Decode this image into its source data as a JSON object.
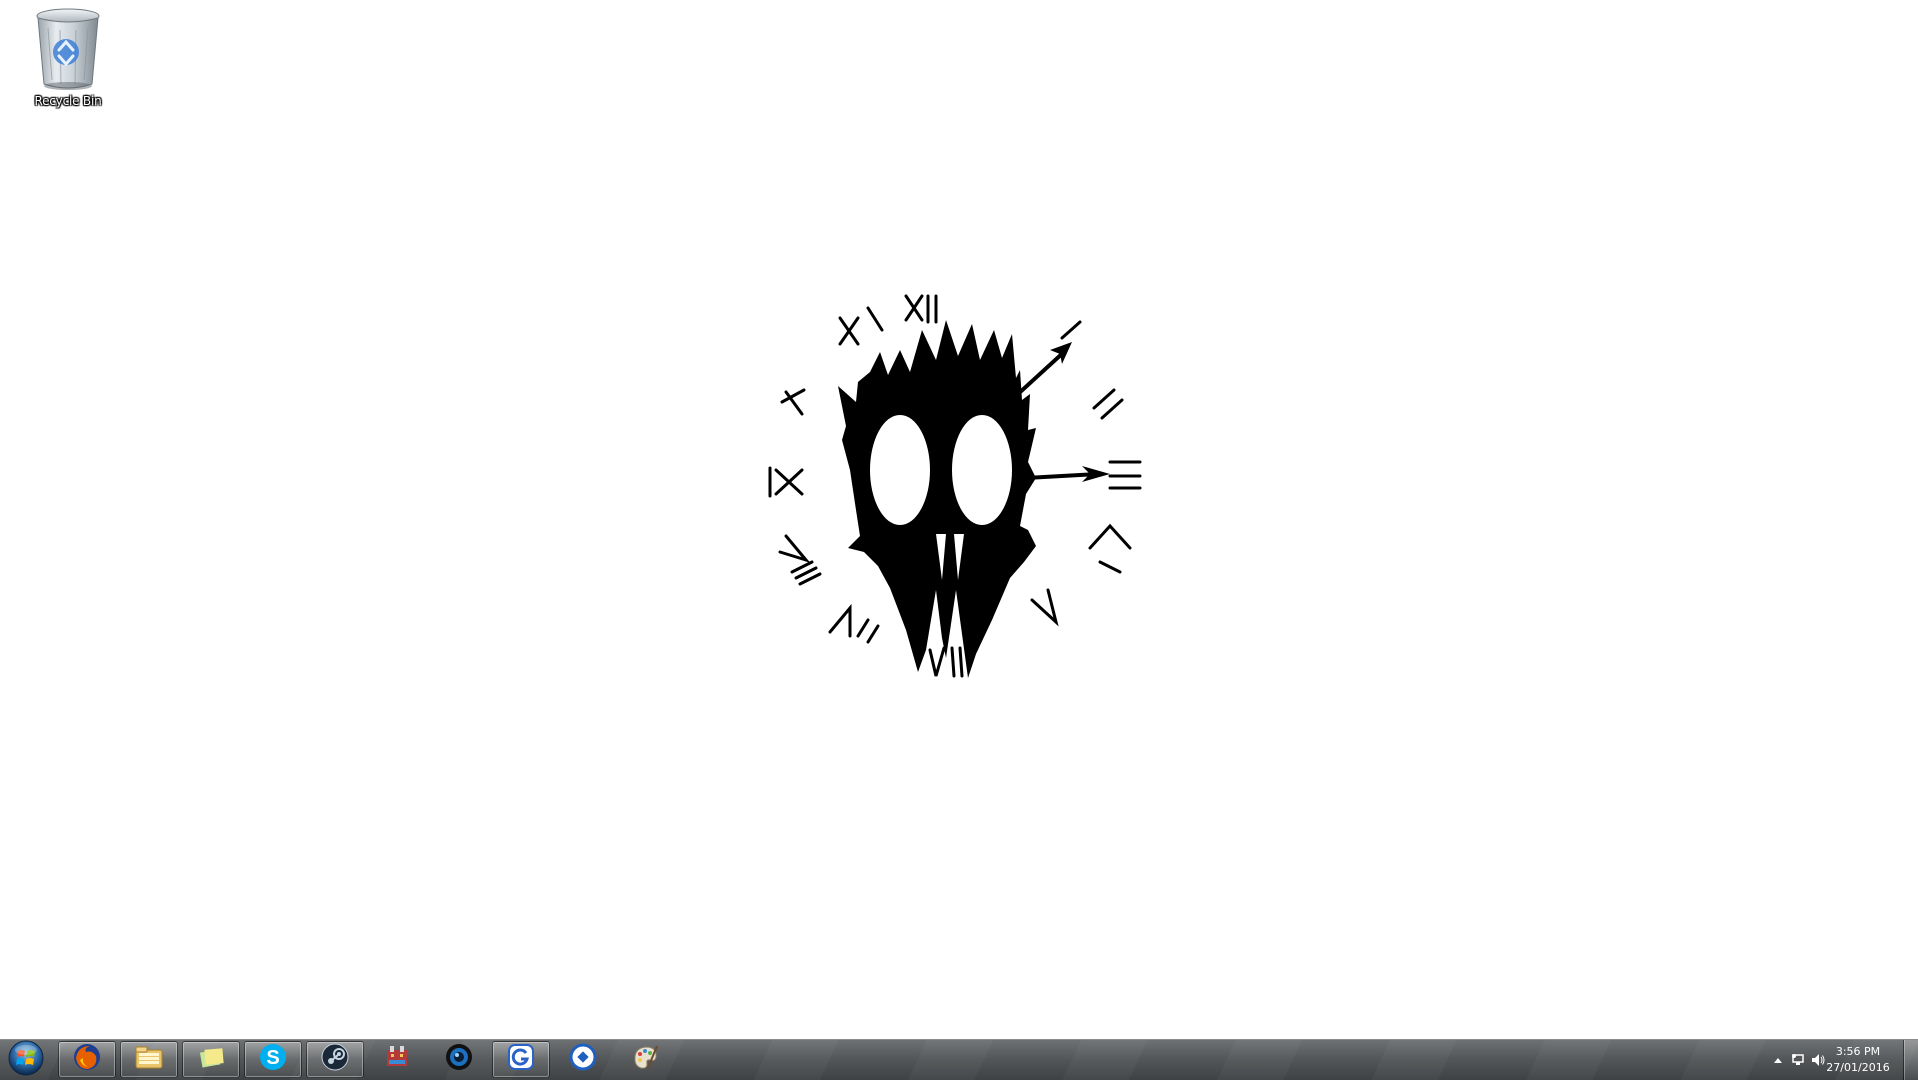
{
  "desktop": {
    "background_color": "#ffffff",
    "icons": [
      {
        "label": "Recycle Bin",
        "icon": "recycle-bin-icon"
      }
    ]
  },
  "wallpaper": {
    "description_icon": "clock-mask-icon",
    "clock_numerals": [
      "XII",
      "I",
      "II",
      "III",
      "IIII",
      "V",
      "VI",
      "VII",
      "VIII",
      "IX",
      "X",
      "XI"
    ]
  },
  "taskbar": {
    "start_icon": "windows-orb-icon",
    "items": [
      {
        "name": "firefox",
        "icon": "firefox-icon",
        "state": "pinned-open"
      },
      {
        "name": "file-explorer",
        "icon": "folder-icon",
        "state": "pinned-open"
      },
      {
        "name": "sticky-notes",
        "icon": "sticky-notes-icon",
        "state": "pinned-open"
      },
      {
        "name": "skype",
        "icon": "skype-icon",
        "state": "pinned-open"
      },
      {
        "name": "steam",
        "icon": "steam-icon",
        "state": "pinned-open"
      },
      {
        "name": "game",
        "icon": "game-icon",
        "state": "pinned"
      },
      {
        "name": "media-player",
        "icon": "media-player-icon",
        "state": "pinned"
      },
      {
        "name": "app-g",
        "icon": "app-g-icon",
        "state": "pinned-open"
      },
      {
        "name": "app-blue",
        "icon": "app-blue-icon",
        "state": "pinned"
      },
      {
        "name": "paint",
        "icon": "paint-icon",
        "state": "pinned"
      }
    ],
    "tray": {
      "icons": [
        "show-hidden-icons-icon",
        "network-icon",
        "volume-icon"
      ],
      "time": "3:56 PM",
      "date": "27/01/2016"
    },
    "colors": {
      "taskbar_top": "#6e7173",
      "taskbar_bottom": "#3f4244",
      "clock_text": "#ffffff"
    }
  }
}
